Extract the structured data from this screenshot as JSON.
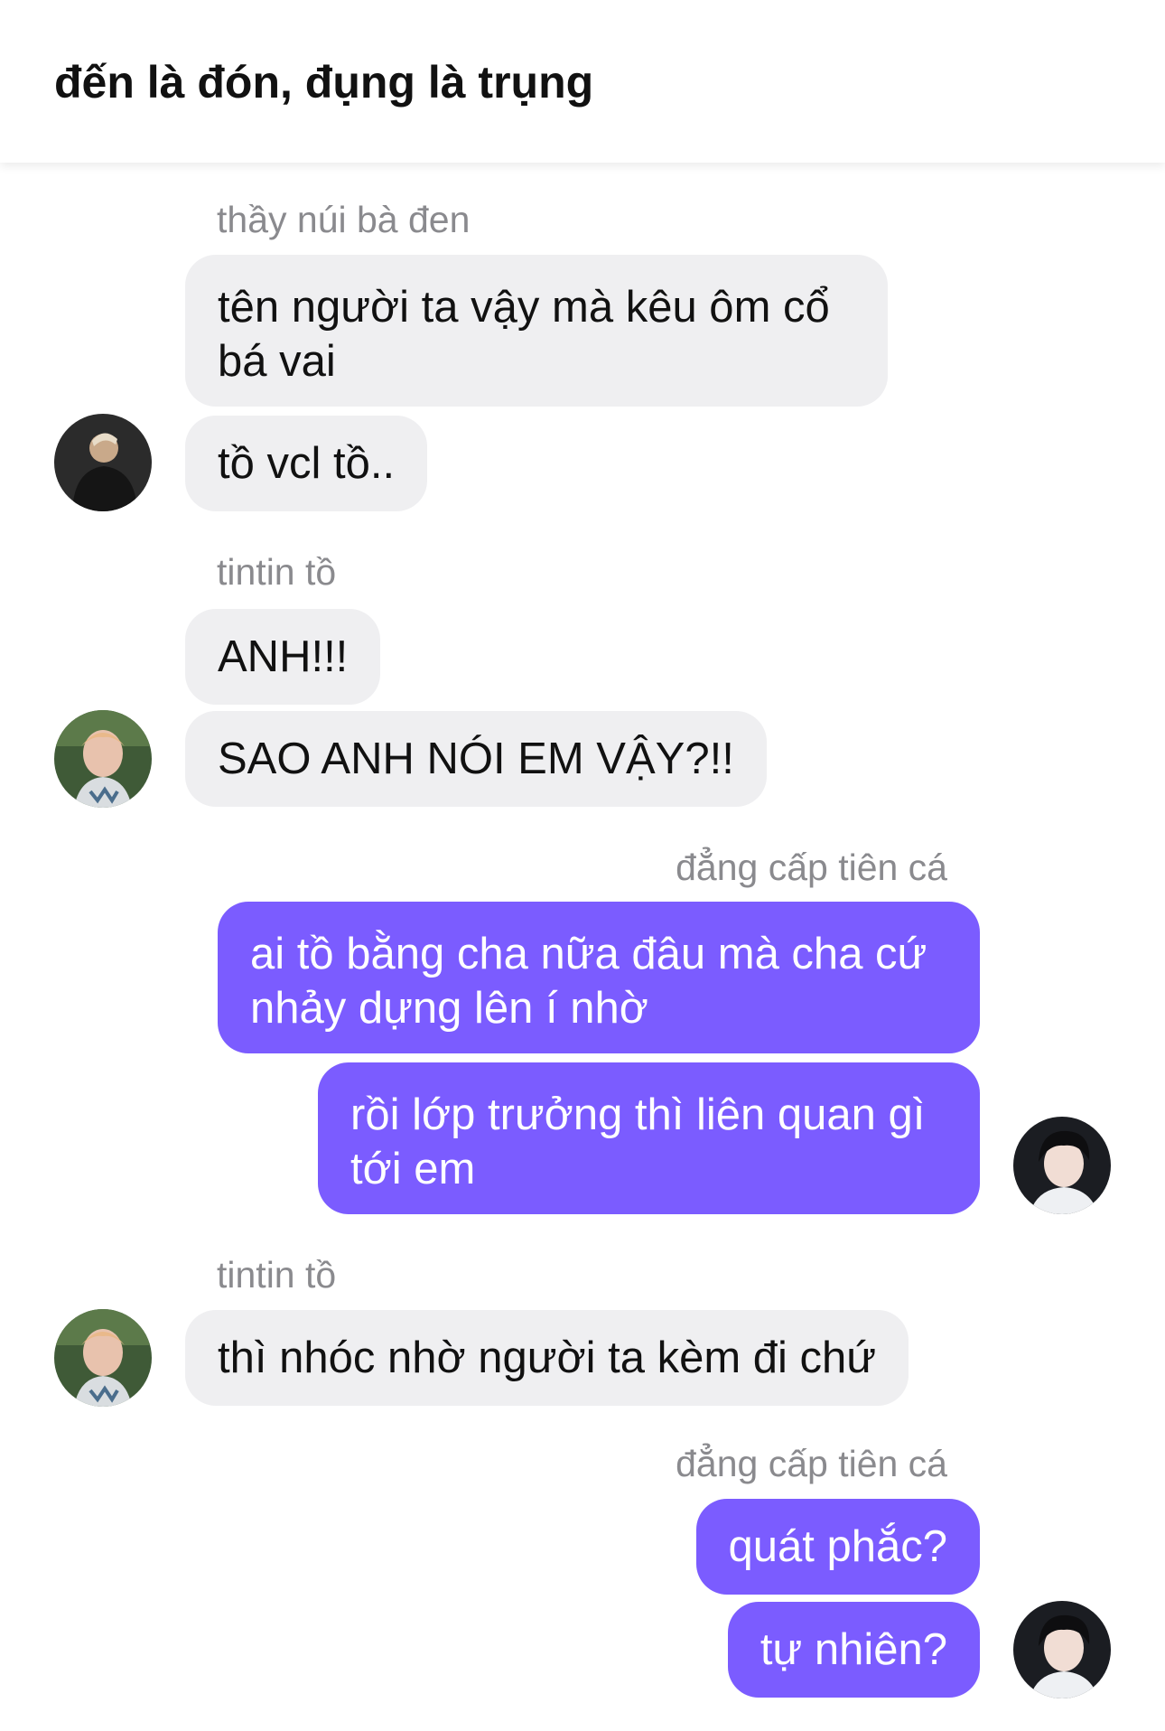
{
  "header": {
    "title": "đến là đón, đụng là trụng"
  },
  "messages": [
    {
      "sender": "thầy núi bà đen",
      "text": "tên người ta vậy mà kêu ôm cổ bá vai"
    },
    {
      "text": "tồ vcl tồ.."
    },
    {
      "sender": "tintin tồ",
      "text": "ANH!!!"
    },
    {
      "text": "SAO ANH NÓI EM VẬY?!!"
    },
    {
      "sender": "đẳng cấp tiên cá",
      "text": "ai tồ bằng cha nữa đâu mà cha cứ nhảy dựng lên í nhờ"
    },
    {
      "text": "rồi lớp trưởng thì liên quan gì tới em"
    },
    {
      "sender": "tintin tồ",
      "text": "thì nhóc nhờ người ta kèm đi chứ"
    },
    {
      "sender": "đẳng cấp tiên cá",
      "text": "quát phắc?"
    },
    {
      "text": "tự nhiên?"
    }
  ],
  "colors": {
    "outgoing_bubble": "#7b5cff",
    "incoming_bubble": "#efeff1",
    "sender_label": "#8a8a8e"
  }
}
